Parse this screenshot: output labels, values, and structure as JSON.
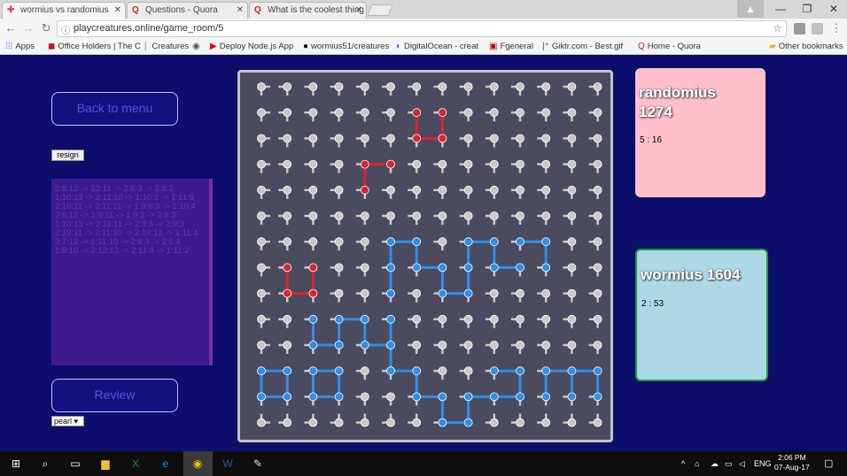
{
  "browser": {
    "tabs": [
      {
        "title": "wormius vs randomius",
        "icon": "game-icon",
        "color": "#e8465d",
        "active": true
      },
      {
        "title": "Questions - Quora",
        "icon": "quora-icon",
        "color": "#b92b27",
        "active": false
      },
      {
        "title": "What is the coolest thing",
        "icon": "quora-icon",
        "color": "#b92b27",
        "active": false
      }
    ],
    "url": "playcreatures.online/game_room/5",
    "bookmarks": [
      "Apps",
      "Office Holders | The C",
      "Creatures",
      "",
      "Deploy Node.js App",
      "wormius51/creatures",
      "DigitalOcean - creat",
      "Fgeneral",
      "Giktr.com - Best.gif",
      "Home - Quora"
    ],
    "other_bookmarks": "Other bookmarks"
  },
  "game": {
    "back_label": "Back to menu",
    "resign_label": "resign",
    "review_label": "Review",
    "select_value": "pearl",
    "moves": [
      "2:8:12 -> 12:11 -> 2:6:3 -> 2:6:2",
      "1:10:13 -> 2:11:10 -> 1:10:2 -> 1:11:5",
      "2:10:11 -> 2:11:11 -> 1:9:6:3 -> 1:10:4",
      "3:6:12 -> 2:9:11 -> 1:9:2 -> 2:9:3",
      "1:10:13 -> 3:11:11 -> 2:9:3 -> 2:9:3",
      "2:10:11 -> 2:11:10 -> 2:10:12 -> 1:11:4",
      "3:7:12 -> 1:11:10 -> 2:6:3 -> 2:6:4",
      "1:6:10 -> 2:12:13 -> 2:11:4 -> 1:11:2"
    ],
    "board": {
      "size": 14,
      "colors": {
        "frame": "#c5c5c5",
        "bg": "#4b4b60",
        "neutral": "#c8c8c8",
        "red": "#d8252f",
        "blue": "#2f8fe8"
      },
      "red_edges": [
        [
          2,
          9,
          2,
          10
        ],
        [
          2,
          10,
          3,
          10
        ],
        [
          3,
          9,
          3,
          10
        ],
        [
          7,
          1,
          7,
          2
        ],
        [
          6,
          1,
          6,
          2
        ],
        [
          6,
          2,
          7,
          2
        ],
        [
          4,
          3,
          5,
          3
        ],
        [
          4,
          3,
          4,
          4
        ],
        [
          1,
          7,
          1,
          8
        ],
        [
          1,
          8,
          2,
          8
        ],
        [
          2,
          7,
          2,
          8
        ]
      ],
      "blue_edges": [
        [
          5,
          6,
          6,
          6
        ],
        [
          5,
          6,
          5,
          7
        ],
        [
          5,
          7,
          5,
          8
        ],
        [
          6,
          6,
          6,
          7
        ],
        [
          6,
          7,
          7,
          7
        ],
        [
          7,
          7,
          7,
          8
        ],
        [
          7,
          8,
          8,
          8
        ],
        [
          8,
          7,
          8,
          8
        ],
        [
          8,
          6,
          8,
          7
        ],
        [
          8,
          6,
          9,
          6
        ],
        [
          9,
          6,
          9,
          7
        ],
        [
          9,
          7,
          10,
          7
        ],
        [
          10,
          6,
          11,
          6
        ],
        [
          11,
          6,
          11,
          7
        ],
        [
          3,
          9,
          4,
          9
        ],
        [
          2,
          9,
          2,
          10
        ],
        [
          3,
          9,
          3,
          10
        ],
        [
          2,
          10,
          3,
          10
        ],
        [
          4,
          9,
          4,
          10
        ],
        [
          4,
          10,
          5,
          10
        ],
        [
          5,
          10,
          5,
          11
        ],
        [
          5,
          11,
          6,
          11
        ],
        [
          5,
          9,
          5,
          10
        ],
        [
          6,
          11,
          6,
          12
        ],
        [
          6,
          12,
          7,
          12
        ],
        [
          0,
          11,
          0,
          12
        ],
        [
          0,
          11,
          1,
          11
        ],
        [
          1,
          11,
          1,
          12
        ],
        [
          0,
          12,
          1,
          12
        ],
        [
          2,
          11,
          2,
          12
        ],
        [
          2,
          11,
          3,
          11
        ],
        [
          3,
          11,
          3,
          12
        ],
        [
          2,
          12,
          3,
          12
        ],
        [
          6,
          11,
          6,
          12
        ],
        [
          7,
          12,
          7,
          13
        ],
        [
          7,
          13,
          8,
          13
        ],
        [
          8,
          12,
          8,
          13
        ],
        [
          8,
          12,
          9,
          12
        ],
        [
          9,
          12,
          10,
          12
        ],
        [
          9,
          11,
          10,
          11
        ],
        [
          10,
          11,
          10,
          12
        ],
        [
          11,
          11,
          11,
          12
        ],
        [
          11,
          11,
          12,
          11
        ],
        [
          12,
          11,
          12,
          12
        ],
        [
          13,
          11,
          13,
          12
        ],
        [
          12,
          11,
          13,
          11
        ]
      ]
    },
    "players": [
      {
        "name": "randomius 1274",
        "time": "5 : 16",
        "color": "#ffc0cb"
      },
      {
        "name": "wormius 1604",
        "time": "2 : 53",
        "color": "#add8e6"
      }
    ]
  },
  "taskbar": {
    "language": "ENG",
    "time": "2:06 PM",
    "date": "07-Aug-17"
  }
}
